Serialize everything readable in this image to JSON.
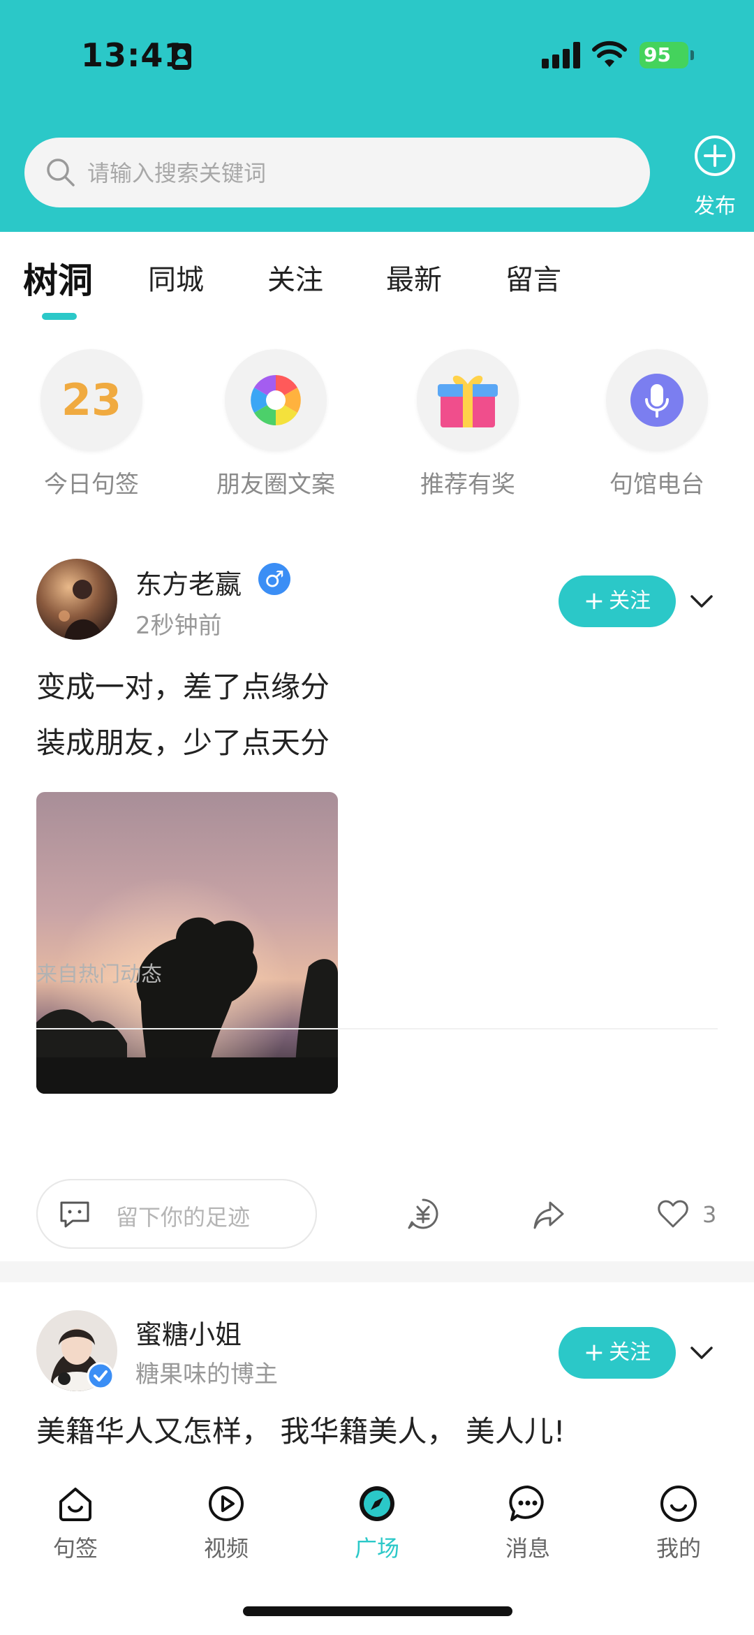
{
  "status_bar": {
    "time": "13:41",
    "battery": "95"
  },
  "header": {
    "search_placeholder": "请输入搜索关键词",
    "publish_label": "发布"
  },
  "tabs": [
    {
      "label": "树洞",
      "active": true
    },
    {
      "label": "同城"
    },
    {
      "label": "关注"
    },
    {
      "label": "最新"
    },
    {
      "label": "留言"
    }
  ],
  "shortcuts": [
    {
      "label": "今日句签",
      "value": "23",
      "icon": "date-icon"
    },
    {
      "label": "朋友圈文案",
      "icon": "aperture-icon"
    },
    {
      "label": "推荐有奖",
      "icon": "gift-icon"
    },
    {
      "label": "句馆电台",
      "icon": "microphone-icon"
    }
  ],
  "posts": [
    {
      "username": "东方老嬴",
      "gender": "♂",
      "subline": "2秒钟前",
      "follow_label": "关注",
      "lines": [
        "变成一对，差了点缘分",
        "装成朋友，少了点天分"
      ],
      "source": "来自热门动态",
      "comment_placeholder": "留下你的足迹",
      "like_count": "3"
    },
    {
      "username": "蜜糖小姐",
      "subline": "糖果味的博主",
      "follow_label": "关注",
      "lines": [
        "美籍华人又怎样， 我华籍美人， 美人儿!"
      ]
    }
  ],
  "bottom_nav": [
    {
      "label": "句签",
      "icon": "home-icon"
    },
    {
      "label": "视频",
      "icon": "play-icon"
    },
    {
      "label": "广场",
      "icon": "compass-icon",
      "active": true
    },
    {
      "label": "消息",
      "icon": "chat-icon"
    },
    {
      "label": "我的",
      "icon": "profile-icon"
    }
  ],
  "colors": {
    "accent": "#2bc8c8",
    "date": "#f0aa40",
    "gender": "#3b8ef5"
  }
}
